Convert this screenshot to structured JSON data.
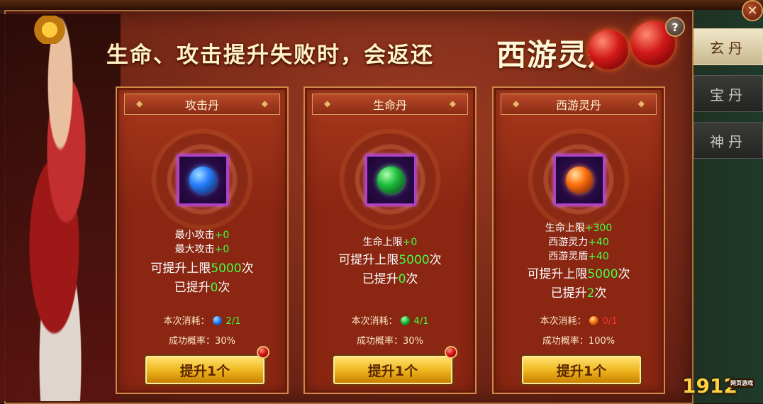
{
  "banner": {
    "text_main": "生命、攻击提升失败时，会返还",
    "text_highlight": "西游灵丹"
  },
  "help_label": "?",
  "close_label": "✕",
  "tabs": [
    {
      "label": "玄丹",
      "active": true
    },
    {
      "label": "宝丹",
      "active": false
    },
    {
      "label": "神丹",
      "active": false
    }
  ],
  "cards": [
    {
      "title": "攻击丹",
      "orb_color": "#2a80ff",
      "stats": [
        {
          "label": "最小攻击",
          "value": "+0"
        },
        {
          "label": "最大攻击",
          "value": "+0"
        }
      ],
      "limit_prefix": "可提升上限",
      "limit_value": "5000",
      "limit_suffix": "次",
      "done_prefix": "已提升",
      "done_value": "0",
      "done_suffix": "次",
      "cost_label": "本次消耗：",
      "cost_value": "2/1",
      "cost_ok": true,
      "rate_label": "成功概率：",
      "rate_value": "30%",
      "button_label": "提升1个"
    },
    {
      "title": "生命丹",
      "orb_color": "#20c040",
      "stats": [
        {
          "label": "生命上限",
          "value": "+0"
        }
      ],
      "limit_prefix": "可提升上限",
      "limit_value": "5000",
      "limit_suffix": "次",
      "done_prefix": "已提升",
      "done_value": "0",
      "done_suffix": "次",
      "cost_label": "本次消耗：",
      "cost_value": "4/1",
      "cost_ok": true,
      "rate_label": "成功概率：",
      "rate_value": "30%",
      "button_label": "提升1个"
    },
    {
      "title": "西游灵丹",
      "orb_color": "#ff7010",
      "stats": [
        {
          "label": "生命上限",
          "value": "+300"
        },
        {
          "label": "西游灵力",
          "value": "+40"
        },
        {
          "label": "西游灵盾",
          "value": "+40"
        }
      ],
      "limit_prefix": "可提升上限",
      "limit_value": "5000",
      "limit_suffix": "次",
      "done_prefix": "已提升",
      "done_value": "2",
      "done_suffix": "次",
      "cost_label": "本次消耗：",
      "cost_value": "0/1",
      "cost_ok": false,
      "rate_label": "成功概率：",
      "rate_value": "100%",
      "button_label": "提升1个"
    }
  ],
  "logo": {
    "main": "1912",
    "badge": "YX",
    "sub": "网页游戏"
  },
  "colors": {
    "positive": "#44ff44",
    "negative": "#ff3030",
    "accent_gold": "#f0b820"
  }
}
